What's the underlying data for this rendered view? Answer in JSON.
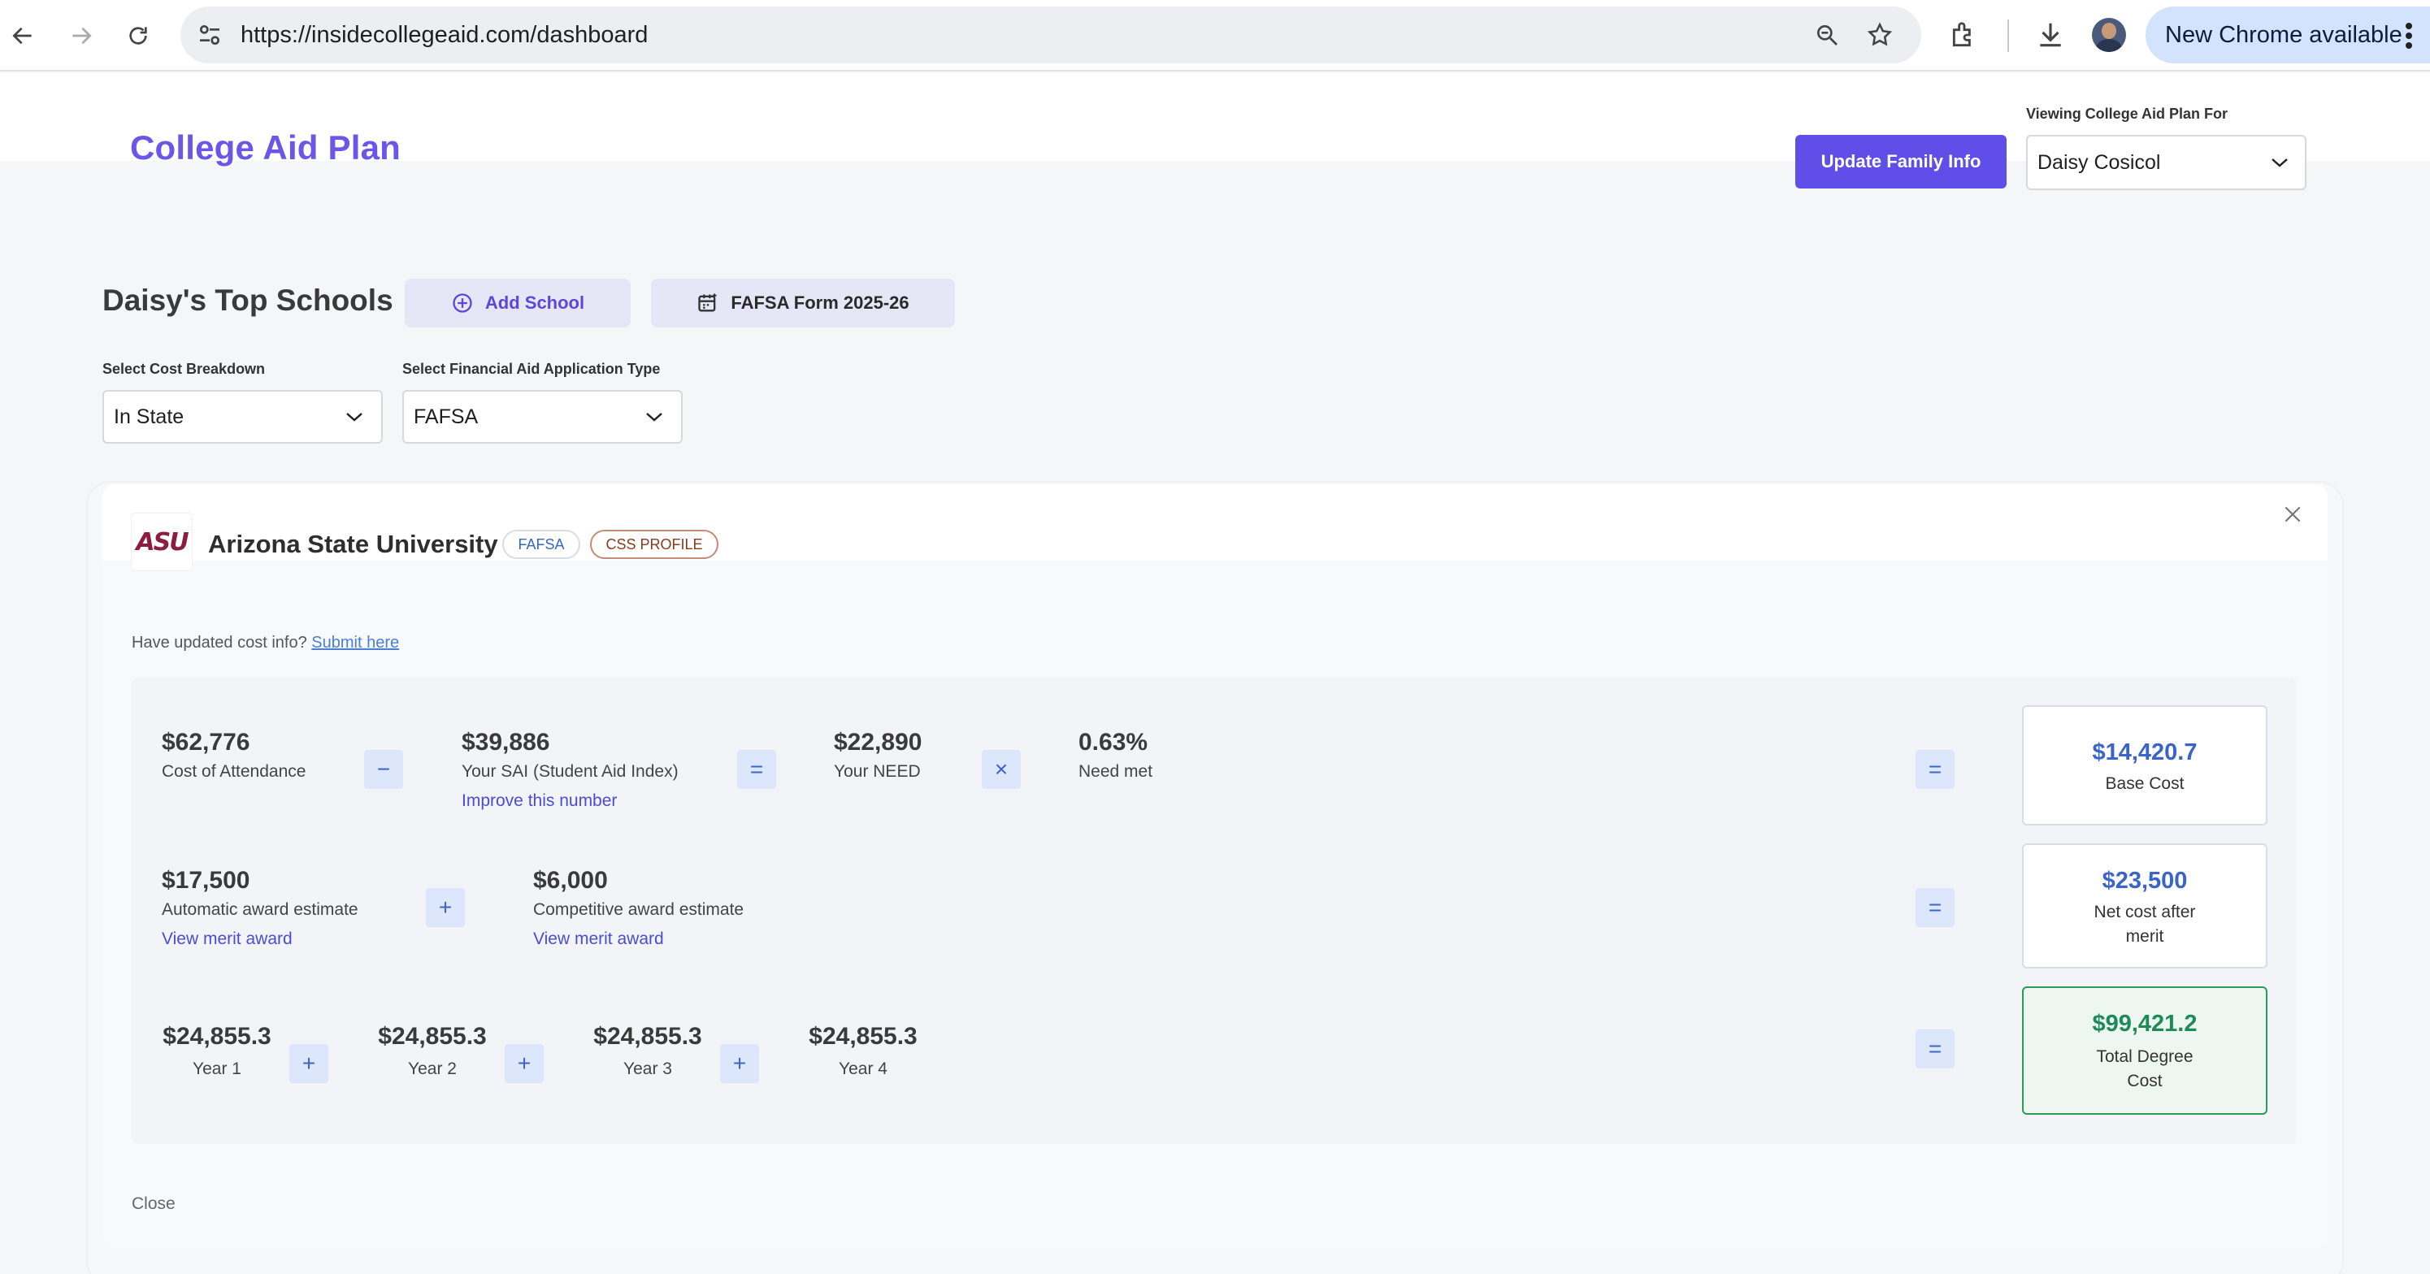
{
  "browser": {
    "url": "https://insidecollegeaid.com/dashboard",
    "update_label": "New Chrome available"
  },
  "header": {
    "brand": "College Aid Plan",
    "update_button": "Update Family Info",
    "viewing_label": "Viewing College Aid Plan For",
    "viewing_value": "Daisy Cosicol"
  },
  "schools": {
    "title": "Daisy's Top Schools",
    "add_school": "Add School",
    "fafsa_form": "FAFSA Form 2025-26",
    "cost_breakdown_label": "Select Cost Breakdown",
    "cost_breakdown_value": "In State",
    "aid_type_label": "Select Financial Aid Application Type",
    "aid_type_value": "FAFSA"
  },
  "card": {
    "school_name": "Arizona State University",
    "logo_text": "ASU",
    "badges": [
      "FAFSA",
      "CSS PROFILE"
    ],
    "updated_note": "Have updated cost info?",
    "submit_link": "Submit here",
    "row1": {
      "coa_value": "$62,776",
      "coa_label": "Cost of Attendance",
      "op1": "−",
      "sai_value": "$39,886",
      "sai_label": "Your SAI (Student Aid Index)",
      "sai_link": "Improve this number",
      "op2": "=",
      "need_value": "$22,890",
      "need_label": "Your NEED",
      "op3": "×",
      "met_value": "0.63%",
      "met_label": "Need met",
      "op_eq": "=",
      "result_value": "$14,420.7",
      "result_label": "Base Cost"
    },
    "row2": {
      "auto_value": "$17,500",
      "auto_label": "Automatic award estimate",
      "auto_link": "View merit award",
      "op1": "+",
      "comp_value": "$6,000",
      "comp_label": "Competitive award estimate",
      "comp_link": "View merit award",
      "op_eq": "=",
      "result_value": "$23,500",
      "result_label_line1": "Net cost after",
      "result_label_line2": "merit"
    },
    "row3": {
      "years": [
        {
          "value": "$24,855.3",
          "label": "Year 1"
        },
        {
          "value": "$24,855.3",
          "label": "Year 2"
        },
        {
          "value": "$24,855.3",
          "label": "Year 3"
        },
        {
          "value": "$24,855.3",
          "label": "Year 4"
        }
      ],
      "op": "+",
      "op_eq": "=",
      "result_value": "$99,421.2",
      "result_label_line1": "Total Degree",
      "result_label_line2": "Cost"
    },
    "close_label": "Close"
  },
  "colors": {
    "brand": "#6a56e8",
    "primary_button": "#5f4fe8",
    "link": "#4b4bd6",
    "result_blue": "#3a64c9",
    "result_green": "#1d8a57",
    "asu_maroon": "#8c1d40"
  }
}
